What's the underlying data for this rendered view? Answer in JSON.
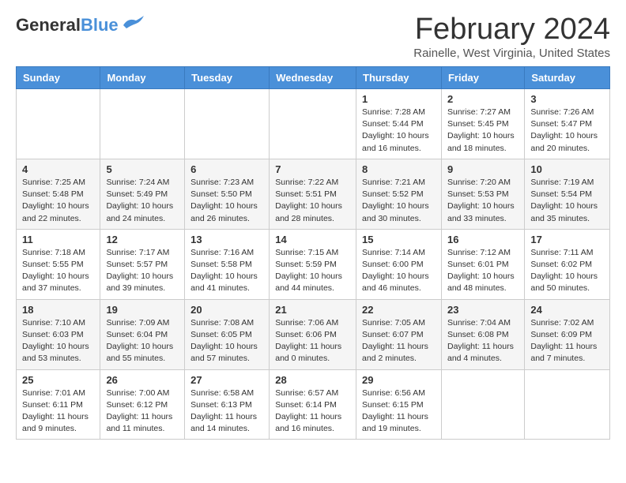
{
  "header": {
    "logo_line1": "General",
    "logo_line2": "Blue",
    "month": "February 2024",
    "location": "Rainelle, West Virginia, United States"
  },
  "days_of_week": [
    "Sunday",
    "Monday",
    "Tuesday",
    "Wednesday",
    "Thursday",
    "Friday",
    "Saturday"
  ],
  "weeks": [
    [
      {
        "day": "",
        "info": ""
      },
      {
        "day": "",
        "info": ""
      },
      {
        "day": "",
        "info": ""
      },
      {
        "day": "",
        "info": ""
      },
      {
        "day": "1",
        "info": "Sunrise: 7:28 AM\nSunset: 5:44 PM\nDaylight: 10 hours\nand 16 minutes."
      },
      {
        "day": "2",
        "info": "Sunrise: 7:27 AM\nSunset: 5:45 PM\nDaylight: 10 hours\nand 18 minutes."
      },
      {
        "day": "3",
        "info": "Sunrise: 7:26 AM\nSunset: 5:47 PM\nDaylight: 10 hours\nand 20 minutes."
      }
    ],
    [
      {
        "day": "4",
        "info": "Sunrise: 7:25 AM\nSunset: 5:48 PM\nDaylight: 10 hours\nand 22 minutes."
      },
      {
        "day": "5",
        "info": "Sunrise: 7:24 AM\nSunset: 5:49 PM\nDaylight: 10 hours\nand 24 minutes."
      },
      {
        "day": "6",
        "info": "Sunrise: 7:23 AM\nSunset: 5:50 PM\nDaylight: 10 hours\nand 26 minutes."
      },
      {
        "day": "7",
        "info": "Sunrise: 7:22 AM\nSunset: 5:51 PM\nDaylight: 10 hours\nand 28 minutes."
      },
      {
        "day": "8",
        "info": "Sunrise: 7:21 AM\nSunset: 5:52 PM\nDaylight: 10 hours\nand 30 minutes."
      },
      {
        "day": "9",
        "info": "Sunrise: 7:20 AM\nSunset: 5:53 PM\nDaylight: 10 hours\nand 33 minutes."
      },
      {
        "day": "10",
        "info": "Sunrise: 7:19 AM\nSunset: 5:54 PM\nDaylight: 10 hours\nand 35 minutes."
      }
    ],
    [
      {
        "day": "11",
        "info": "Sunrise: 7:18 AM\nSunset: 5:55 PM\nDaylight: 10 hours\nand 37 minutes."
      },
      {
        "day": "12",
        "info": "Sunrise: 7:17 AM\nSunset: 5:57 PM\nDaylight: 10 hours\nand 39 minutes."
      },
      {
        "day": "13",
        "info": "Sunrise: 7:16 AM\nSunset: 5:58 PM\nDaylight: 10 hours\nand 41 minutes."
      },
      {
        "day": "14",
        "info": "Sunrise: 7:15 AM\nSunset: 5:59 PM\nDaylight: 10 hours\nand 44 minutes."
      },
      {
        "day": "15",
        "info": "Sunrise: 7:14 AM\nSunset: 6:00 PM\nDaylight: 10 hours\nand 46 minutes."
      },
      {
        "day": "16",
        "info": "Sunrise: 7:12 AM\nSunset: 6:01 PM\nDaylight: 10 hours\nand 48 minutes."
      },
      {
        "day": "17",
        "info": "Sunrise: 7:11 AM\nSunset: 6:02 PM\nDaylight: 10 hours\nand 50 minutes."
      }
    ],
    [
      {
        "day": "18",
        "info": "Sunrise: 7:10 AM\nSunset: 6:03 PM\nDaylight: 10 hours\nand 53 minutes."
      },
      {
        "day": "19",
        "info": "Sunrise: 7:09 AM\nSunset: 6:04 PM\nDaylight: 10 hours\nand 55 minutes."
      },
      {
        "day": "20",
        "info": "Sunrise: 7:08 AM\nSunset: 6:05 PM\nDaylight: 10 hours\nand 57 minutes."
      },
      {
        "day": "21",
        "info": "Sunrise: 7:06 AM\nSunset: 6:06 PM\nDaylight: 11 hours\nand 0 minutes."
      },
      {
        "day": "22",
        "info": "Sunrise: 7:05 AM\nSunset: 6:07 PM\nDaylight: 11 hours\nand 2 minutes."
      },
      {
        "day": "23",
        "info": "Sunrise: 7:04 AM\nSunset: 6:08 PM\nDaylight: 11 hours\nand 4 minutes."
      },
      {
        "day": "24",
        "info": "Sunrise: 7:02 AM\nSunset: 6:09 PM\nDaylight: 11 hours\nand 7 minutes."
      }
    ],
    [
      {
        "day": "25",
        "info": "Sunrise: 7:01 AM\nSunset: 6:11 PM\nDaylight: 11 hours\nand 9 minutes."
      },
      {
        "day": "26",
        "info": "Sunrise: 7:00 AM\nSunset: 6:12 PM\nDaylight: 11 hours\nand 11 minutes."
      },
      {
        "day": "27",
        "info": "Sunrise: 6:58 AM\nSunset: 6:13 PM\nDaylight: 11 hours\nand 14 minutes."
      },
      {
        "day": "28",
        "info": "Sunrise: 6:57 AM\nSunset: 6:14 PM\nDaylight: 11 hours\nand 16 minutes."
      },
      {
        "day": "29",
        "info": "Sunrise: 6:56 AM\nSunset: 6:15 PM\nDaylight: 11 hours\nand 19 minutes."
      },
      {
        "day": "",
        "info": ""
      },
      {
        "day": "",
        "info": ""
      }
    ]
  ]
}
